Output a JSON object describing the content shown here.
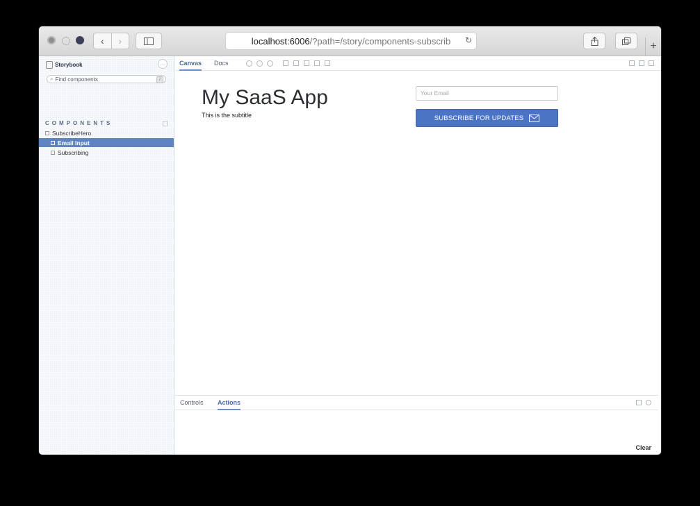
{
  "browser": {
    "url_host": "localhost:6006",
    "url_path": "/?path=/story/components-subscrib"
  },
  "storybook": {
    "brand": "Storybook",
    "search_placeholder": "Find components",
    "search_shortcut": "/",
    "section_label": "COMPONENTS",
    "tree": [
      {
        "label": "SubscribeHero",
        "selected": false
      },
      {
        "label": "Email Input",
        "selected": true
      },
      {
        "label": "Subscribing",
        "selected": false
      }
    ],
    "tabs": {
      "canvas": "Canvas",
      "docs": "Docs"
    }
  },
  "story": {
    "title": "My SaaS App",
    "subtitle": "This is the subtitle",
    "email_placeholder": "Your Email",
    "button_label": "SUBSCRIBE FOR UPDATES"
  },
  "addons": {
    "tabs": {
      "controls": "Controls",
      "actions": "Actions"
    },
    "active_tab": "Actions",
    "clear_label": "Clear"
  },
  "colors": {
    "accent": "#4c74c4",
    "selected_item": "#5f84c1"
  }
}
